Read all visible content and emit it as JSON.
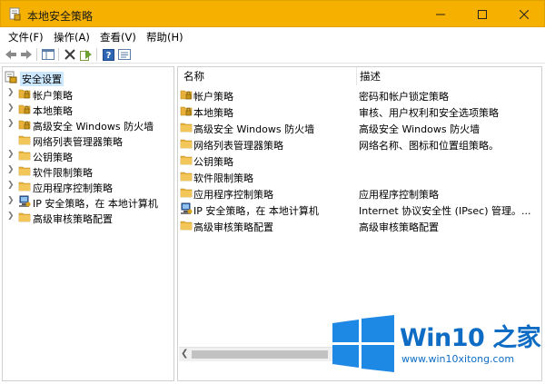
{
  "window": {
    "title": "本地安全策略"
  },
  "menu": [
    "文件(F)",
    "操作(A)",
    "查看(V)",
    "帮助(H)"
  ],
  "toolbar": [
    "back-icon",
    "forward-icon",
    "show-tree-icon",
    "delete-icon",
    "export-icon",
    "help-icon",
    "properties-icon"
  ],
  "tree": {
    "root": "安全设置",
    "items": [
      {
        "label": "帐户策略",
        "expandable": true,
        "icon": "folder-lock-icon"
      },
      {
        "label": "本地策略",
        "expandable": true,
        "icon": "folder-lock-icon"
      },
      {
        "label": "高级安全 Windows 防火墙",
        "expandable": true,
        "icon": "folder-lock-icon"
      },
      {
        "label": "网络列表管理器策略",
        "expandable": false,
        "icon": "folder-icon"
      },
      {
        "label": "公钥策略",
        "expandable": true,
        "icon": "folder-icon"
      },
      {
        "label": "软件限制策略",
        "expandable": true,
        "icon": "folder-icon"
      },
      {
        "label": "应用程序控制策略",
        "expandable": true,
        "icon": "folder-icon"
      },
      {
        "label": "IP 安全策略，在 本地计算机",
        "expandable": true,
        "icon": "ipsec-icon"
      },
      {
        "label": "高级审核策略配置",
        "expandable": true,
        "icon": "folder-icon"
      }
    ]
  },
  "list": {
    "headers": {
      "name": "名称",
      "desc": "描述"
    },
    "rows": [
      {
        "name": "帐户策略",
        "desc": "密码和帐户锁定策略",
        "icon": "folder-lock-icon"
      },
      {
        "name": "本地策略",
        "desc": "审核、用户权利和安全选项策略",
        "icon": "folder-lock-icon"
      },
      {
        "name": "高级安全 Windows 防火墙",
        "desc": "高级安全 Windows 防火墙",
        "icon": "folder-icon"
      },
      {
        "name": "网络列表管理器策略",
        "desc": "网络名称、图标和位置组策略。",
        "icon": "folder-icon"
      },
      {
        "name": "公钥策略",
        "desc": "",
        "icon": "folder-icon"
      },
      {
        "name": "软件限制策略",
        "desc": "",
        "icon": "folder-icon"
      },
      {
        "name": "应用程序控制策略",
        "desc": "应用程序控制策略",
        "icon": "folder-icon"
      },
      {
        "name": "IP 安全策略，在 本地计算机",
        "desc": "Internet 协议安全性 (IPsec) 管理。...",
        "icon": "ipsec-icon"
      },
      {
        "name": "高级审核策略配置",
        "desc": "高级审核策略配置",
        "icon": "folder-icon"
      }
    ]
  },
  "watermark": {
    "brand": "Win10 之家",
    "url": "www.win10xitong.com"
  },
  "colors": {
    "titlebar": "#f6b000",
    "selection": "#cce8ff",
    "folder": "#e8b23a",
    "watermark": "#0e6cc4"
  }
}
